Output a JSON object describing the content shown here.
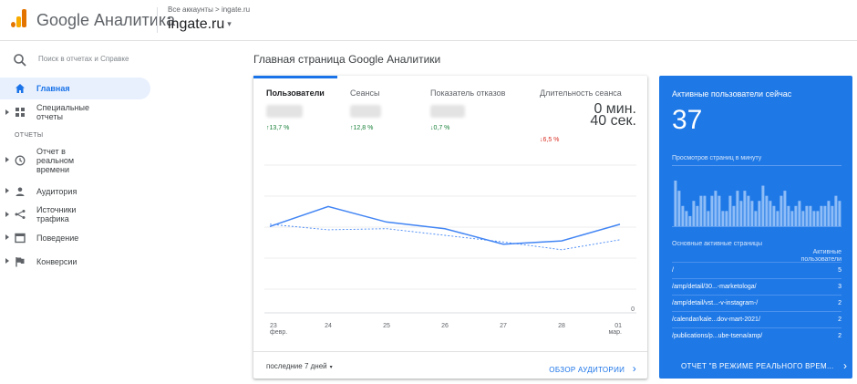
{
  "header": {
    "brand": "Google Аналитика",
    "breadcrumb": "Все аккаунты > ingate.ru",
    "account": "ingate.ru",
    "account_caret": "▾"
  },
  "sidebar": {
    "search_placeholder": "Поиск в отчетах и Справке",
    "items": [
      {
        "label": "Главная",
        "icon": "home-icon",
        "active": true
      },
      {
        "label": "Специальные отчеты",
        "icon": "dashboard-grid-icon"
      }
    ],
    "section_reports": "ОТЧЕТЫ",
    "reports": [
      {
        "label": "Отчет в реальном времени",
        "icon": "clock-icon"
      },
      {
        "label": "Аудитория",
        "icon": "person-icon"
      },
      {
        "label": "Источники трафика",
        "icon": "acquisition-icon"
      },
      {
        "label": "Поведение",
        "icon": "behavior-icon"
      },
      {
        "label": "Конверсии",
        "icon": "flag-icon"
      }
    ]
  },
  "main": {
    "title": "Главная страница Google Аналитики",
    "tabs": [
      {
        "label": "Пользователи",
        "delta": "↑13,7 %",
        "direction": "up"
      },
      {
        "label": "Сеансы",
        "delta": "↑12,8 %",
        "direction": "up"
      },
      {
        "label": "Показатель отказов",
        "delta": "↓0,7 %",
        "direction": "up"
      },
      {
        "label": "Длительность сеанса",
        "value": "0 мин.\n40 сек.",
        "delta": "↓6,5 %",
        "direction": "down"
      }
    ],
    "footer": {
      "range": "последние 7 дней",
      "range_caret": "▾",
      "audience_link": "ОБЗОР АУДИТОРИИ",
      "audience_chevron": "›"
    }
  },
  "chart_data": {
    "type": "line",
    "categories": [
      "23\nфевр.",
      "24",
      "25",
      "26",
      "27",
      "28",
      "01\nмар."
    ],
    "series": [
      {
        "values": [
          78,
          96,
          82,
          76,
          62,
          65,
          80
        ],
        "style": "solid",
        "color": "#4285f4"
      },
      {
        "values": [
          80,
          75,
          76,
          70,
          64,
          57,
          66
        ],
        "style": "dashed",
        "color": "#4285f4"
      }
    ],
    "ylim": [
      0,
      140
    ],
    "y_tick_label": "0",
    "grid": true
  },
  "realtime": {
    "title": "Активные пользователи сейчас",
    "count": "37",
    "pageviews_label": "Просмотров страниц в минуту",
    "bars": [
      9,
      7,
      4,
      3,
      2,
      5,
      4,
      6,
      6,
      3,
      6,
      7,
      6,
      3,
      3,
      6,
      4,
      7,
      5,
      7,
      6,
      5,
      3,
      5,
      8,
      6,
      5,
      4,
      3,
      6,
      7,
      4,
      3,
      4,
      5,
      3,
      4,
      4,
      3,
      3,
      4,
      4,
      5,
      4,
      6,
      5
    ],
    "table_header_page": "Основные активные страницы",
    "table_header_users": "Активные пользователи",
    "rows": [
      {
        "page": "/",
        "users": "5"
      },
      {
        "page": "/amp/detail/30...-marketologa/",
        "users": "3"
      },
      {
        "page": "/amp/detail/vst...-v-instagram-/",
        "users": "2"
      },
      {
        "page": "/calendar/kale...dov-mart-2021/",
        "users": "2"
      },
      {
        "page": "/publications/p...ube-tsena/amp/",
        "users": "2"
      }
    ],
    "footer_link": "ОТЧЕТ \"В РЕЖИМЕ РЕАЛЬНОГО ВРЕМ...",
    "footer_chevron": "›"
  }
}
